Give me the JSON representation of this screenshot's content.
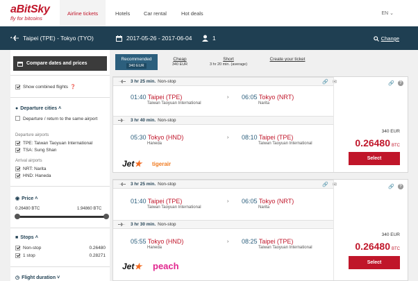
{
  "brand": {
    "name": "aBitSky",
    "tagline": "fly for bitcoins"
  },
  "nav": {
    "items": [
      "Airline tickets",
      "Hotels",
      "Car rental",
      "Hot deals"
    ],
    "lang": "EN"
  },
  "search": {
    "route": "Taipei (TPE) - Tokyo (TYO)",
    "dates": "2017-05-26 - 2017-06-04",
    "passengers": "1",
    "change": "Change"
  },
  "sidebar": {
    "compare": "Compare dates and prices",
    "show_combined": "Show combined flights",
    "departure_title": "Departure cities",
    "same_airport": "Departure / return to the same airport",
    "dep_airports_label": "Departure airports",
    "dep_airports": [
      "TPE: Taiwan Taoyuan International",
      "TSA: Sung Shan"
    ],
    "arr_airports_label": "Arrival airports",
    "arr_airports": [
      "NRT: Narita",
      "HND: Haneda"
    ],
    "price_title": "Price",
    "price_min": "0.26480 BTC",
    "price_max": "1.94860 BTC",
    "stops_title": "Stops",
    "stops": [
      {
        "label": "Non-stop",
        "value": "0.26480"
      },
      {
        "label": "1 stop",
        "value": "0.28271"
      }
    ],
    "duration_title": "Flight duration"
  },
  "tabs": [
    {
      "label": "Recommended",
      "value": "340 EUR"
    },
    {
      "label": "Cheap",
      "value": "340 EUR"
    },
    {
      "label": "Short",
      "value": "3 hr 20 min. (average)"
    },
    {
      "label": "Create your ticket",
      "value": ""
    }
  ],
  "results": [
    {
      "legs": [
        {
          "duration": "3 hr 25 min.",
          "stops": "Non-stop",
          "dep_time": "01:40",
          "dep_city": "Taipei (TPE)",
          "dep_airport": "Taiwan Taoyuan International",
          "arr_time": "06:05",
          "arr_city": "Tokyo (NRT)",
          "arr_airport": "Narita"
        },
        {
          "duration": "3 hr 40 min.",
          "stops": "Non-stop",
          "dep_time": "05:30",
          "dep_city": "Tokyo (HND)",
          "dep_airport": "Haneda",
          "arr_time": "08:10",
          "arr_city": "Taipei (TPE)",
          "arr_airport": "Taiwan Taoyuan International"
        }
      ],
      "price_eur": "340 EUR",
      "price_btc": "0.26480",
      "btc_unit": "BTC",
      "select": "Select",
      "airlines": [
        "Jet",
        "tigerair"
      ]
    },
    {
      "legs": [
        {
          "duration": "3 hr 25 min.",
          "stops": "Non-stop",
          "dep_time": "01:40",
          "dep_city": "Taipei (TPE)",
          "dep_airport": "Taiwan Taoyuan International",
          "arr_time": "06:05",
          "arr_city": "Tokyo (NRT)",
          "arr_airport": "Narita"
        },
        {
          "duration": "3 hr 30 min.",
          "stops": "Non-stop",
          "dep_time": "05:55",
          "dep_city": "Tokyo (HND)",
          "dep_airport": "Haneda",
          "arr_time": "08:25",
          "arr_city": "Taipei (TPE)",
          "arr_airport": "Taiwan Taoyuan International"
        }
      ],
      "price_eur": "340 EUR",
      "price_btc": "0.26480",
      "btc_unit": "BTC",
      "select": "Select",
      "airlines": [
        "Jet",
        "peach"
      ]
    }
  ],
  "colors": {
    "brand_red": "#c0162a",
    "navy": "#1f3f52",
    "tab_active": "#2c5f7d",
    "jetstar_orange": "#f26b21",
    "peach_pink": "#e2268f"
  }
}
